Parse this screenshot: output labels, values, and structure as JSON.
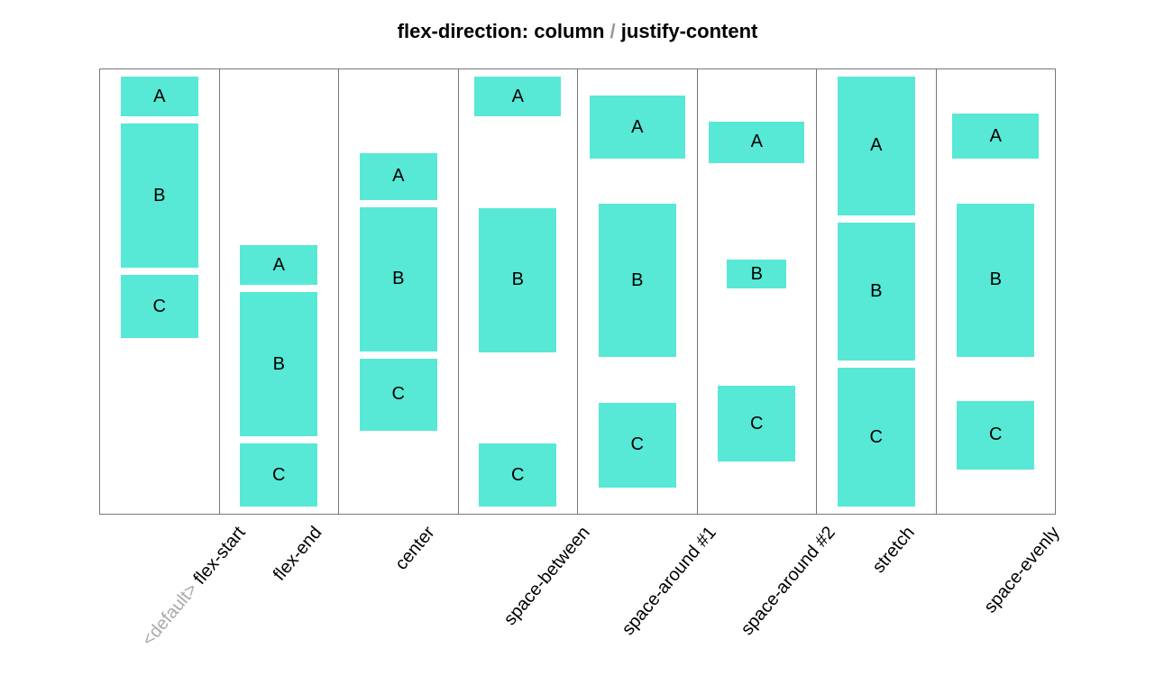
{
  "title_a": "flex-direction: column",
  "title_sep": " / ",
  "title_b": "justify-content",
  "default_prefix": "<default> ",
  "item_labels": [
    "A",
    "B",
    "C"
  ],
  "columns": [
    {
      "mode": "flex-start",
      "label": "flex-start",
      "is_default": true,
      "heights": [
        44,
        160,
        70
      ],
      "widths": [
        86,
        86,
        86
      ]
    },
    {
      "mode": "flex-end",
      "label": "flex-end",
      "is_default": false,
      "heights": [
        44,
        160,
        70
      ],
      "widths": [
        86,
        86,
        86
      ]
    },
    {
      "mode": "center",
      "label": "center",
      "is_default": false,
      "heights": [
        52,
        160,
        80
      ],
      "widths": [
        86,
        86,
        86
      ]
    },
    {
      "mode": "space-between",
      "label": "space-between",
      "is_default": false,
      "heights": [
        44,
        160,
        70
      ],
      "widths": [
        96,
        86,
        86
      ]
    },
    {
      "mode": "space-around",
      "label": "space-around #1",
      "is_default": false,
      "heights": [
        70,
        170,
        94
      ],
      "widths": [
        106,
        86,
        86
      ]
    },
    {
      "mode": "space-around",
      "label": "space-around #2",
      "is_default": false,
      "heights": [
        46,
        32,
        84
      ],
      "widths": [
        106,
        66,
        86
      ]
    },
    {
      "mode": "stretch",
      "label": "stretch",
      "is_default": false,
      "heights": [
        0,
        0,
        0
      ],
      "widths": [
        86,
        86,
        86
      ]
    },
    {
      "mode": "space-evenly",
      "label": "space-evenly",
      "is_default": false,
      "heights": [
        50,
        170,
        76
      ],
      "widths": [
        96,
        86,
        86
      ]
    }
  ],
  "colors": {
    "box_bg": "#57e8d6",
    "border": "#777",
    "muted": "#aaa"
  }
}
